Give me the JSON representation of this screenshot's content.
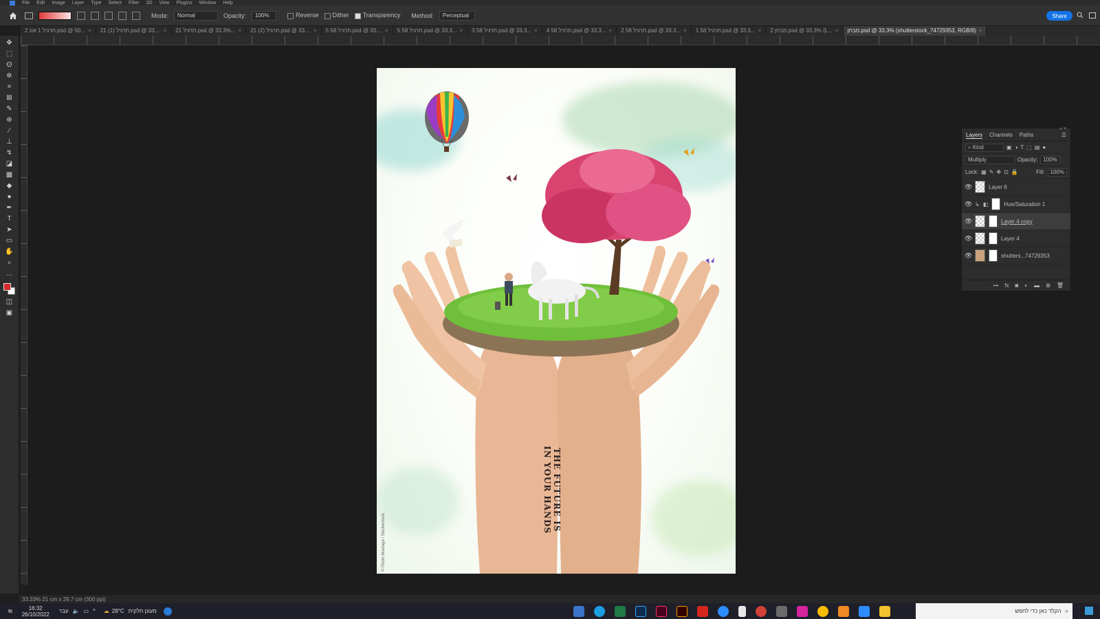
{
  "menubar": {
    "items": [
      "File",
      "Edit",
      "Image",
      "Layer",
      "Type",
      "Select",
      "Filter",
      "3D",
      "View",
      "Plugins",
      "Window",
      "Help"
    ]
  },
  "options_bar": {
    "mode_label": "Mode:",
    "mode_value": "Normal",
    "opacity_label": "Opacity:",
    "opacity_value": "100%",
    "reverse_label": "Reverse",
    "dither_label": "Dither",
    "transparency_label": "Transparency",
    "method_label": "Method:",
    "method_value": "Perceptual",
    "share_label": "Share",
    "gradient_colors": [
      "#e03b3b",
      "#fbe3e3"
    ]
  },
  "tabs": [
    {
      "label": "2 תרגיל 1 אונ.psd @ 50..."
    },
    {
      "label": "21 תרגיל (1).psd @ 33...."
    },
    {
      "label": "21 תרגיל.psd @ 33.3%..."
    },
    {
      "label": "21 תרגיל (2).psd @ 33...."
    },
    {
      "label": "5 58 תרגיל.psd @ 33...."
    },
    {
      "label": "5 58 תרגיל.psd @ 33.3..."
    },
    {
      "label": "3 58 תרגיל.psd @ 33.3..."
    },
    {
      "label": "4 58 תרגיל.psd @ 33.3..."
    },
    {
      "label": "2 58 תרגיל.psd @ 33.3..."
    },
    {
      "label": "1 58 תרגיל.psd @ 33.3..."
    },
    {
      "label": "2 מבחן.psd @ 33.3% (L..."
    },
    {
      "label": "מבחן.psd @ 33.3% (shutterstock_74729353, RGB/8)"
    }
  ],
  "active_tab_index": 11,
  "document": {
    "tattoo_line1": "THE FUTURE IS",
    "tattoo_line2": "IN YOUR HANDS",
    "credit": "© Photo Montage / Shutterstock"
  },
  "layers_panel": {
    "tabs": [
      "Layers",
      "Channels",
      "Paths"
    ],
    "kind_label": "Kind",
    "blend_mode": "Multiply",
    "opacity_label": "Opacity:",
    "opacity_value": "100%",
    "lock_label": "Lock:",
    "fill_label": "Fill:",
    "fill_value": "100%",
    "layers": [
      {
        "name": "Layer 6"
      },
      {
        "name": "Hue/Saturation 1"
      },
      {
        "name": "Layer 4 copy"
      },
      {
        "name": "Layer 4"
      },
      {
        "name": "shutters...74729353"
      }
    ]
  },
  "status": {
    "text": "33.33%    21 cm x 29.7 cm (300 ppi)"
  },
  "taskbar": {
    "time": "16:32",
    "date": "26/10/2022",
    "lang": "עבר",
    "weather": "28°C",
    "weather_desc": "מעונן חלקית",
    "search_placeholder": "הקלד כאן כדי לחפש"
  }
}
